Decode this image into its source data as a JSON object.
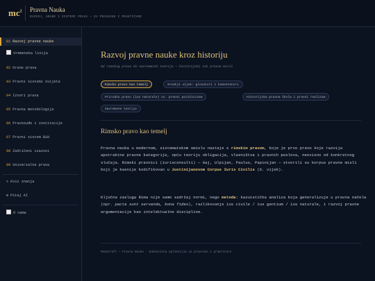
{
  "header": {
    "logo": "mc",
    "logo_sup": "2",
    "title": "Pravna Nauka",
    "subtitle": "RAZVOJ, GRANE I SISTEMI PRAVA — ZA PRAVNIKE I PRAKTIČARE"
  },
  "sidebar": {
    "items": [
      {
        "num": "01",
        "label": "Razvoj pravne nauke"
      },
      {
        "num": "",
        "label": "Vremenska linija"
      },
      {
        "num": "02",
        "label": "Grane prava"
      },
      {
        "num": "03",
        "label": "Pravni sistemi svijeta"
      },
      {
        "num": "04",
        "label": "Izvori prava"
      },
      {
        "num": "05",
        "label": "Pravna metodologija"
      },
      {
        "num": "06",
        "label": "Pravosuđe i institucije"
      },
      {
        "num": "07",
        "label": "Pravni sistem BiH"
      },
      {
        "num": "08",
        "label": "Zaštićeni izazovi"
      },
      {
        "num": "09",
        "label": "Univerzalna prava"
      }
    ],
    "tools": [
      {
        "glyph": "✎",
        "label": "Kviz znanja"
      },
      {
        "glyph": "⚙",
        "label": "Pitaj AI"
      }
    ],
    "about": "O nama"
  },
  "main": {
    "title": "Razvoj pravne nauke kroz historiju",
    "lead": "Od rimskog prava do savremenih teorija — historijski tok pravne misli",
    "chips": [
      "Rimsko pravo kao temelj",
      "Srednji vijek: glosatori i komentatori",
      "Prirodno pravo (ius naturale) vs. pravni pozitivizam",
      "Historijska pravna škola i pravni realizam",
      "Savremene teorije"
    ],
    "section_title": "Rimsko pravo kao temelj",
    "p1": {
      "t1": "Pravna nauka u modernom, sistematskom smislu nastaje s ",
      "b1": "rimskim pravom",
      "t2": ", koje je prvo pravo koje razvija apstraktne pravne kategorije, opću teoriju obligacija, vlasništva i pravnih poslova, neovisno od konkretnog slučaja. Rimski pravnici (iurisconsulti) — Gaj, Ulpijan, Paulus, Papinijan — stvorili su korpus pravne misli koji je kasnije kodifikovan u ",
      "b2": "Justinijanovom Corpus Iuris Civilis",
      "t3": " (6. vijek)."
    },
    "p2": {
      "t1": "Ključna zasluga Rima nije samo sadržaj normi, nego ",
      "b1": "metoda",
      "t2": ": kazuistička analiza koja generalizuje u pravna načela (npr. ",
      "i1": "pacta sunt servanda, bona fides",
      "t3": "), razlikovanje ius civile / ius gentium / ius naturale, i razvoj pravne argumentacije kao intelektualne discipline."
    },
    "footer": "MemiCraft — Pravna Nauka · Edukativna aplikacija za pravnike i praktičare"
  }
}
